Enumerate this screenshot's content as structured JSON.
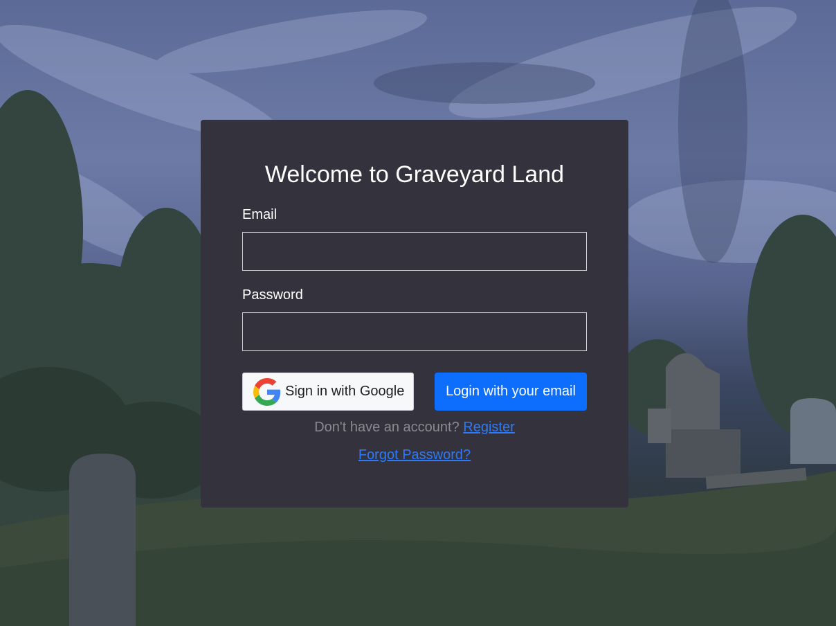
{
  "card": {
    "title": "Welcome to Graveyard Land"
  },
  "form": {
    "email_label": "Email",
    "email_value": "",
    "password_label": "Password",
    "password_value": ""
  },
  "buttons": {
    "google_label": "Sign in with Google",
    "email_login_label": "Login with your email"
  },
  "footer": {
    "register_prompt": "Don't have an account?",
    "register_link": "Register",
    "forgot_link": "Forgot Password?"
  },
  "icons": {
    "google": "google-g-icon"
  },
  "colors": {
    "card_bg": "#33323d",
    "primary": "#0d6efd",
    "link": "#2f7bf5",
    "muted_text": "#8a8a93"
  }
}
